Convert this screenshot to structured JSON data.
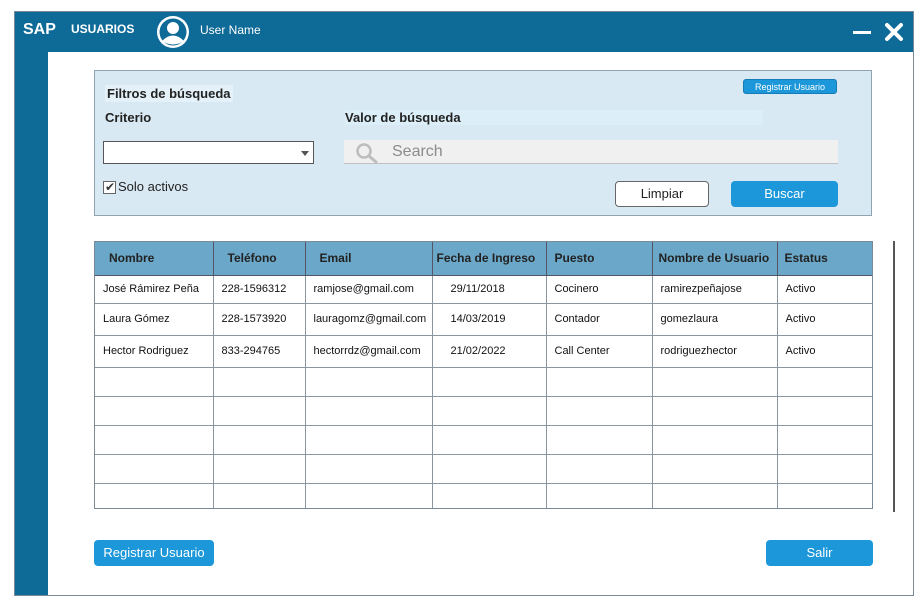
{
  "app": {
    "brand": "SAP",
    "section": "USUARIOS",
    "user_name": "User Name"
  },
  "window_controls": {
    "minimize_icon": "minus-icon",
    "close_icon": "close-icon"
  },
  "filters": {
    "title": "Filtros de búsqueda",
    "criterio_label": "Criterio",
    "criterio_value": "",
    "valor_label": "Valor de búsqueda",
    "search_placeholder": "Search",
    "solo_activos_label": "Solo activos",
    "solo_activos_checked": true,
    "registrar_small_label": "Registrar Usuario",
    "limpiar_label": "Limpiar",
    "buscar_label": "Buscar"
  },
  "table": {
    "headers": [
      "Nombre",
      "Teléfono",
      "Email",
      "Fecha de Ingreso",
      "Puesto",
      "Nombre de Usuario",
      "Estatus"
    ],
    "rows": [
      [
        "José Rámirez Peña",
        "228-1596312",
        "ramjose@gmail.com",
        "29/11/2018",
        "Cocinero",
        "ramirezpeñajose",
        "Activo"
      ],
      [
        "Laura Gómez",
        "228-1573920",
        "lauragomz@gmail.com",
        "14/03/2019",
        "Contador",
        "gomezlaura",
        "Activo"
      ],
      [
        "Hector Rodriguez",
        "833-294765",
        "hectorrdz@gmail.com",
        "21/02/2022",
        "Call Center",
        "rodriguezhector",
        "Activo"
      ]
    ],
    "empty_rows": 5
  },
  "footer": {
    "registrar_label": "Registrar Usuario",
    "salir_label": "Salir"
  },
  "colors": {
    "titlebar": "#0e6a97",
    "button": "#1c97d9",
    "filters_bg": "#d9e9f3",
    "header_bg": "#6aa7c8"
  }
}
